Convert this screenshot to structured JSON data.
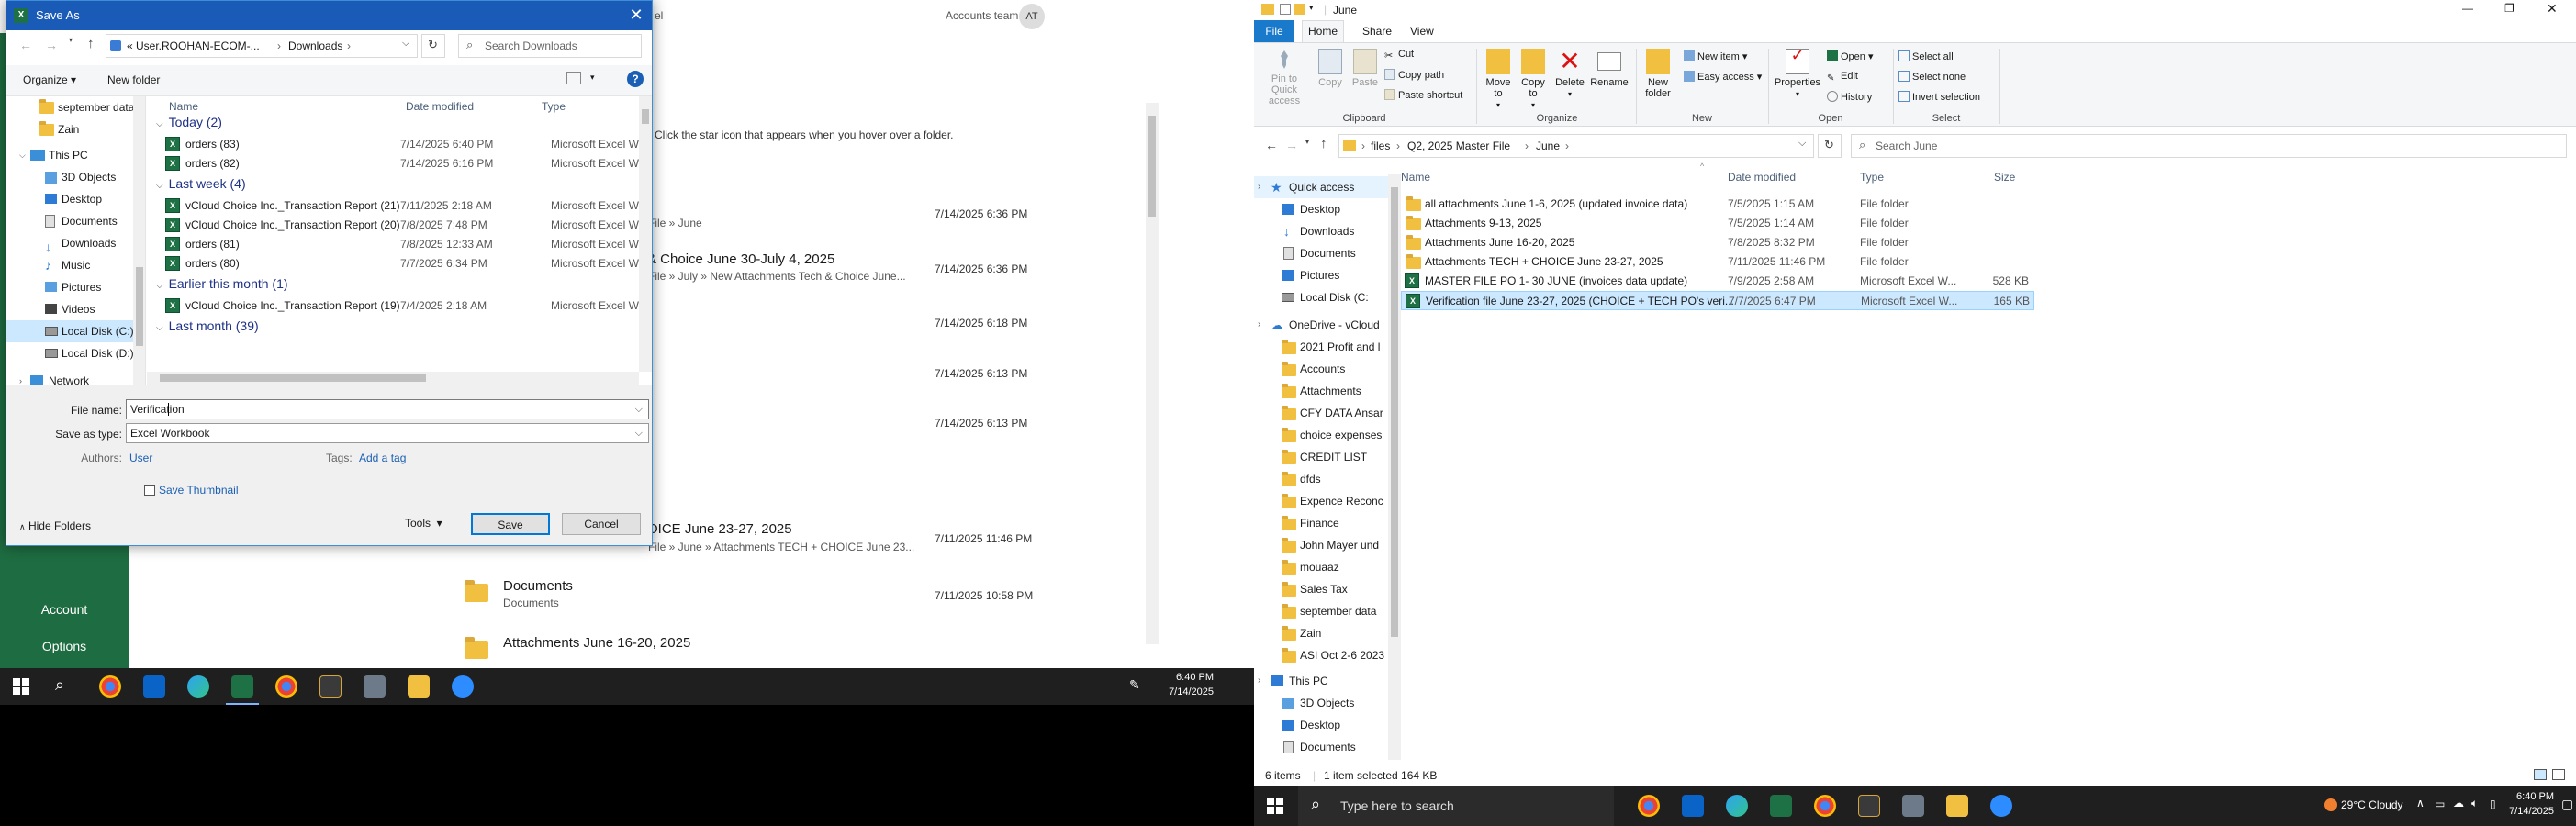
{
  "colors": {
    "dialog_title": "#1a5bb8",
    "excel_green": "#1e6c41",
    "taskbar": "#1f1f1f",
    "folder_yellow": "#f2c040",
    "link_blue": "#1a5fb4",
    "selection": "#cce8ff"
  },
  "excel_backstage": {
    "title_suffix": "el",
    "user_name": "Accounts team",
    "user_initials": "AT",
    "hint": "r. Click the star icon that appears when you hover over a folder.",
    "nav": {
      "account": "Account",
      "options": "Options"
    },
    "rows": [
      {
        "title": "",
        "sub": "File » June",
        "date": "7/14/2025 6:36 PM"
      },
      {
        "title": "& Choice June 30-July 4, 2025",
        "sub": "File » July » New Attachments Tech & Choice June...",
        "date": "7/14/2025 6:36 PM"
      },
      {
        "title": "",
        "sub": "",
        "date": "7/14/2025 6:18 PM"
      },
      {
        "title": "",
        "sub": "",
        "date": "7/14/2025 6:13 PM"
      },
      {
        "title": "",
        "sub": "",
        "date": "7/14/2025 6:13 PM"
      },
      {
        "title": "OICE  June 23-27, 2025",
        "sub": "File » June » Attachments TECH + CHOICE  June 23...",
        "date": "7/11/2025 11:46 PM"
      },
      {
        "title": "Documents",
        "sub": "Documents",
        "date": "7/11/2025 10:58 PM"
      },
      {
        "title": "Attachments June 16-20, 2025",
        "sub": "",
        "date": ""
      }
    ]
  },
  "save_dialog": {
    "title": "Save As",
    "breadcrumb": [
      "«  User.ROOHAN-ECOM-...",
      "Downloads"
    ],
    "search_placeholder": "Search Downloads",
    "organize": "Organize",
    "new_folder": "New folder",
    "columns": {
      "name": "Name",
      "date": "Date modified",
      "type": "Type"
    },
    "nav_items": [
      "september data",
      "Zain",
      "This PC",
      "3D Objects",
      "Desktop",
      "Documents",
      "Downloads",
      "Music",
      "Pictures",
      "Videos",
      "Local Disk (C:)",
      "Local Disk (D:)",
      "Network"
    ],
    "groups": [
      {
        "label": "Today (2)",
        "files": [
          {
            "name": "orders (83)",
            "date": "7/14/2025 6:40 PM",
            "type": "Microsoft Excel W..."
          },
          {
            "name": "orders (82)",
            "date": "7/14/2025 6:16 PM",
            "type": "Microsoft Excel W..."
          }
        ]
      },
      {
        "label": "Last week (4)",
        "files": [
          {
            "name": "vCloud Choice Inc._Transaction Report (21)",
            "date": "7/11/2025 2:18 AM",
            "type": "Microsoft Excel W..."
          },
          {
            "name": "vCloud Choice Inc._Transaction Report (20)",
            "date": "7/8/2025 7:48 PM",
            "type": "Microsoft Excel W..."
          },
          {
            "name": "orders (81)",
            "date": "7/8/2025 12:33 AM",
            "type": "Microsoft Excel W..."
          },
          {
            "name": "orders (80)",
            "date": "7/7/2025 6:34 PM",
            "type": "Microsoft Excel W..."
          }
        ]
      },
      {
        "label": "Earlier this month (1)",
        "files": [
          {
            "name": "vCloud Choice Inc._Transaction Report (19)",
            "date": "7/4/2025 2:18 AM",
            "type": "Microsoft Excel W..."
          }
        ]
      },
      {
        "label": "Last month (39)",
        "files": []
      }
    ],
    "file_name_label": "File name:",
    "file_name_value": "Verification",
    "save_type_label": "Save as type:",
    "save_type_value": "Excel Workbook",
    "authors_label": "Authors:",
    "authors_value": "User",
    "tags_label": "Tags:",
    "tags_value": "Add a tag",
    "thumbnail_label": "Save Thumbnail",
    "hide_folders": "Hide Folders",
    "tools": "Tools",
    "save": "Save",
    "cancel": "Cancel"
  },
  "left_taskbar": {
    "time": "6:40 PM",
    "date": "7/14/2025"
  },
  "explorer": {
    "title": "June",
    "tabs": [
      "File",
      "Home",
      "Share",
      "View"
    ],
    "ribbon": {
      "pin": "Pin to Quick access",
      "copy": "Copy",
      "paste": "Paste",
      "cut": "Cut",
      "copy_path": "Copy path",
      "paste_shortcut": "Paste shortcut",
      "move_to": "Move to",
      "copy_to": "Copy to",
      "delete": "Delete",
      "rename": "Rename",
      "new_folder": "New folder",
      "new_item": "New item",
      "easy_access": "Easy access",
      "properties": "Properties",
      "open": "Open",
      "edit": "Edit",
      "history": "History",
      "select_all": "Select all",
      "select_none": "Select none",
      "invert_selection": "Invert selection",
      "groups": {
        "clipboard": "Clipboard",
        "organize": "Organize",
        "new": "New",
        "open": "Open",
        "select": "Select"
      }
    },
    "breadcrumb": [
      "files",
      "Q2, 2025 Master File",
      "June"
    ],
    "search_placeholder": "Search June",
    "columns": {
      "name": "Name",
      "date": "Date modified",
      "type": "Type",
      "size": "Size"
    },
    "nav_items": [
      "Quick access",
      "Desktop",
      "Downloads",
      "Documents",
      "Pictures",
      "Local Disk (C:",
      "OneDrive - vCloud",
      "2021 Profit and l",
      "Accounts",
      "Attachments",
      "CFY DATA Ansar",
      "choice expenses",
      "CREDIT LIST",
      "dfds",
      "Expence Reconc",
      "Finance",
      "John Mayer und",
      "mouaaz",
      "Sales Tax",
      "september data",
      "Zain",
      "ASI Oct 2-6 2023",
      "This PC",
      "3D Objects",
      "Desktop",
      "Documents"
    ],
    "files": [
      {
        "name": "all attachments June 1-6, 2025 (updated invoice data)",
        "date": "7/5/2025 1:15 AM",
        "type": "File folder",
        "size": "",
        "kind": "folder"
      },
      {
        "name": "Attachments 9-13, 2025",
        "date": "7/5/2025 1:14 AM",
        "type": "File folder",
        "size": "",
        "kind": "folder"
      },
      {
        "name": "Attachments June 16-20, 2025",
        "date": "7/8/2025 8:32 PM",
        "type": "File folder",
        "size": "",
        "kind": "folder"
      },
      {
        "name": "Attachments TECH + CHOICE  June 23-27, 2025",
        "date": "7/11/2025 11:46 PM",
        "type": "File folder",
        "size": "",
        "kind": "folder"
      },
      {
        "name": "MASTER FILE PO 1- 30 JUNE (invoices data update)",
        "date": "7/9/2025 2:58 AM",
        "type": "Microsoft Excel W...",
        "size": "528 KB",
        "kind": "excel"
      },
      {
        "name": "Verification file June 23-27, 2025 (CHOICE + TECH PO's veri...",
        "date": "7/7/2025 6:47 PM",
        "type": "Microsoft Excel W...",
        "size": "165 KB",
        "kind": "excel"
      }
    ],
    "status": {
      "count": "6 items",
      "selected": "1 item selected  164 KB"
    }
  },
  "right_taskbar": {
    "search_placeholder": "Type here to search",
    "weather": "29°C  Cloudy",
    "time": "6:40 PM",
    "date": "7/14/2025"
  }
}
